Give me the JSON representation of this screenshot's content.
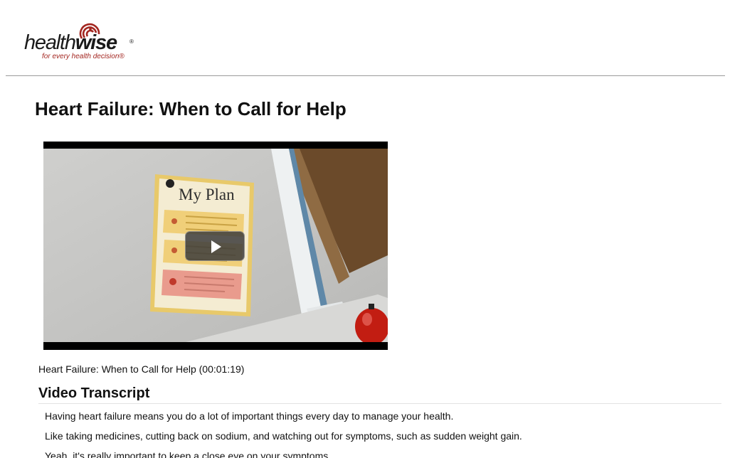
{
  "header": {
    "logo": {
      "word_part1": "health",
      "word_part2": "wise",
      "registered": "®",
      "tagline": "for every health decision®",
      "accent_color": "#a32620"
    }
  },
  "page": {
    "title": "Heart Failure: When to Call for Help"
  },
  "video": {
    "poster_text": "My Plan",
    "play_icon": "play-icon",
    "caption": "Heart Failure: When to Call for Help (00:01:19)"
  },
  "transcript": {
    "heading": "Video Transcript",
    "paragraphs": [
      "Having heart failure means you do a lot of important things every day to manage your health.",
      "Like taking medicines, cutting back on sodium, and watching out for symptoms, such as sudden weight gain.",
      "Yeah, it's really important to keep a close eye on your symptoms."
    ]
  }
}
